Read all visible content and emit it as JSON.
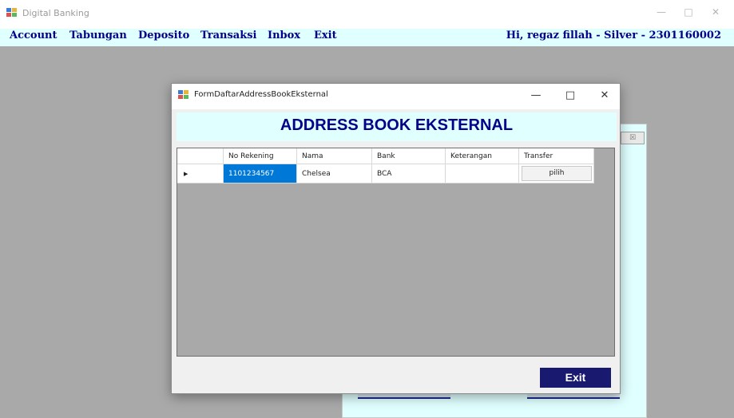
{
  "main_window": {
    "title": "Digital Banking",
    "controls": {
      "minimize": "—",
      "maximize": "□",
      "close": "✕"
    }
  },
  "menubar": {
    "items": [
      "Account",
      "Tabungan",
      "Deposito",
      "Transaksi",
      "Inbox",
      "Exit"
    ],
    "greeting": "Hi, regaz fillah - Silver - 2301160002"
  },
  "dialog": {
    "title": "FormDaftarAddressBookEksternal",
    "controls": {
      "minimize": "—",
      "maximize": "□",
      "close": "✕"
    },
    "heading": "ADDRESS BOOK EKSTERNAL",
    "table": {
      "columns": [
        "",
        "No Rekening",
        "Nama",
        "Bank",
        "Keterangan",
        "Transfer"
      ],
      "rows": [
        {
          "indicator": "▶",
          "no_rekening": "1101234567",
          "nama": "Chelsea",
          "bank": "BCA",
          "keterangan": "",
          "transfer_label": "pilih"
        }
      ]
    },
    "exit_label": "Exit"
  },
  "background_window": {
    "close_glyph": "☒"
  },
  "colors": {
    "accent_navy": "#00008b",
    "button_navy": "#191970",
    "band": "#e0ffff",
    "selection": "#0078d7",
    "desktop": "#a9a9a9"
  },
  "icons": [
    "app-icon",
    "minimize-icon",
    "maximize-icon",
    "close-icon",
    "row-indicator-icon"
  ]
}
